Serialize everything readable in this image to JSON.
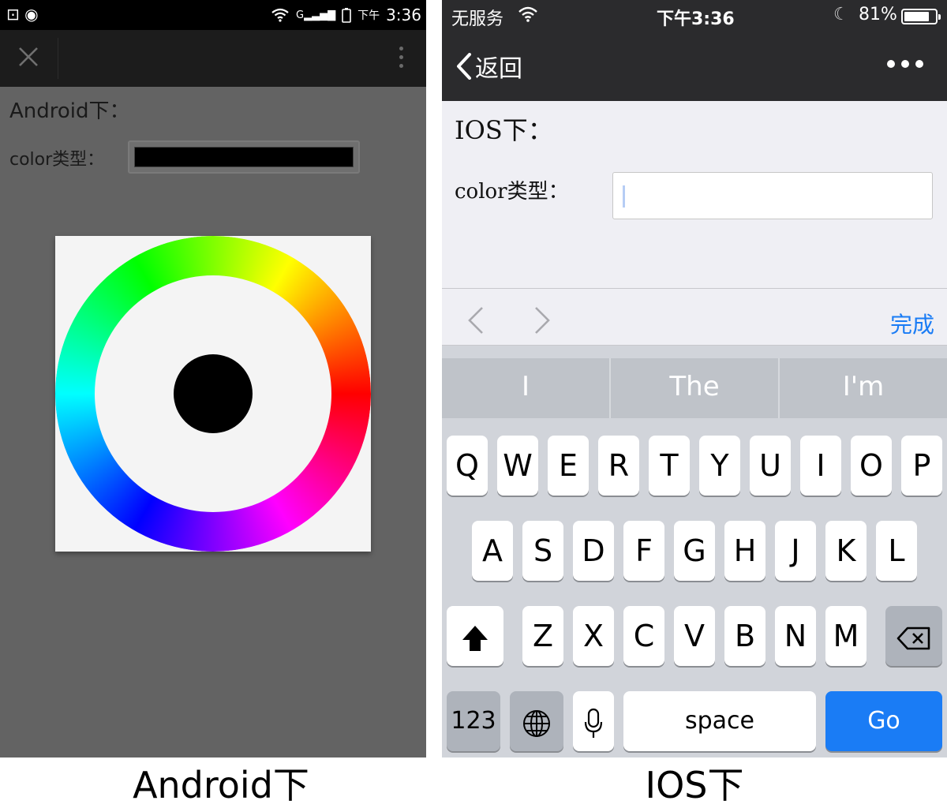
{
  "android": {
    "status_time": "3:36",
    "status_ampm": "下午",
    "status_signal": "G",
    "title": "Android下：",
    "color_label": "color类型：",
    "color_value": "#000000",
    "close_icon": "close-icon",
    "more_icon": "more-vertical-icon"
  },
  "ios": {
    "carrier": "无服务",
    "time": "下午3:36",
    "battery": "81%",
    "back_label": "返回",
    "title": "IOS下：",
    "color_label": "color类型：",
    "done_label": "完成",
    "suggestions": [
      "I",
      "The",
      "I'm"
    ],
    "keyboard": {
      "row1": [
        "Q",
        "W",
        "E",
        "R",
        "T",
        "Y",
        "U",
        "I",
        "O",
        "P"
      ],
      "row2": [
        "A",
        "S",
        "D",
        "F",
        "G",
        "H",
        "J",
        "K",
        "L"
      ],
      "row3": [
        "Z",
        "X",
        "C",
        "V",
        "B",
        "N",
        "M"
      ],
      "numbers_label": "123",
      "space_label": "space",
      "go_label": "Go"
    },
    "accent_color": "#1a7cf5"
  },
  "captions": {
    "left": "Android下",
    "right": "IOS下"
  }
}
